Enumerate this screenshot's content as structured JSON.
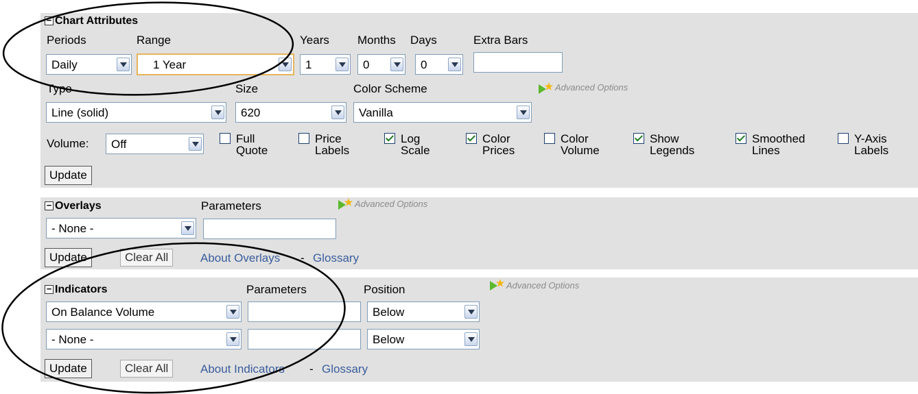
{
  "chart_attributes": {
    "title": "Chart Attributes",
    "periods_label": "Periods",
    "range_label": "Range",
    "years_label": "Years",
    "months_label": "Months",
    "days_label": "Days",
    "extra_bars_label": "Extra Bars",
    "periods_value": "Daily",
    "range_value": "1 Year",
    "years_value": "1",
    "months_value": "0",
    "days_value": "0",
    "extra_bars_value": "",
    "type_label": "Type",
    "size_label": "Size",
    "color_scheme_label": "Color Scheme",
    "advanced_options": "Advanced Options",
    "type_value": "Line (solid)",
    "size_value": "620",
    "color_scheme_value": "Vanilla",
    "volume_label": "Volume:",
    "volume_value": "Off",
    "checkboxes": [
      {
        "label": "Full\nQuote",
        "checked": false
      },
      {
        "label": "Price\nLabels",
        "checked": false
      },
      {
        "label": "Log\nScale",
        "checked": true
      },
      {
        "label": "Color\nPrices",
        "checked": true
      },
      {
        "label": "Color\nVolume",
        "checked": false
      },
      {
        "label": "Show\nLegends",
        "checked": true
      },
      {
        "label": "Smoothed\nLines",
        "checked": true
      },
      {
        "label": "Y-Axis\nLabels",
        "checked": false
      }
    ],
    "update_label": "Update"
  },
  "overlays": {
    "title": "Overlays",
    "parameters_label": "Parameters",
    "advanced_options": "Advanced Options",
    "overlay_value": "- None -",
    "parameters_value": "",
    "update_label": "Update",
    "clear_all_label": "Clear All",
    "about_link": "About Overlays",
    "separator": "-",
    "glossary_link": "Glossary"
  },
  "indicators": {
    "title": "Indicators",
    "parameters_label": "Parameters",
    "position_label": "Position",
    "advanced_options": "Advanced Options",
    "rows": [
      {
        "indicator": "On Balance Volume",
        "parameters": "",
        "position": "Below"
      },
      {
        "indicator": "- None -",
        "parameters": "",
        "position": "Below"
      }
    ],
    "update_label": "Update",
    "clear_all_label": "Clear All",
    "about_link": "About Indicators",
    "separator": "-",
    "glossary_link": "Glossary"
  },
  "colors": {
    "panel_bg": "#e1e1e1",
    "link": "#3a5d9c",
    "range_highlight": "#e8b45a"
  }
}
